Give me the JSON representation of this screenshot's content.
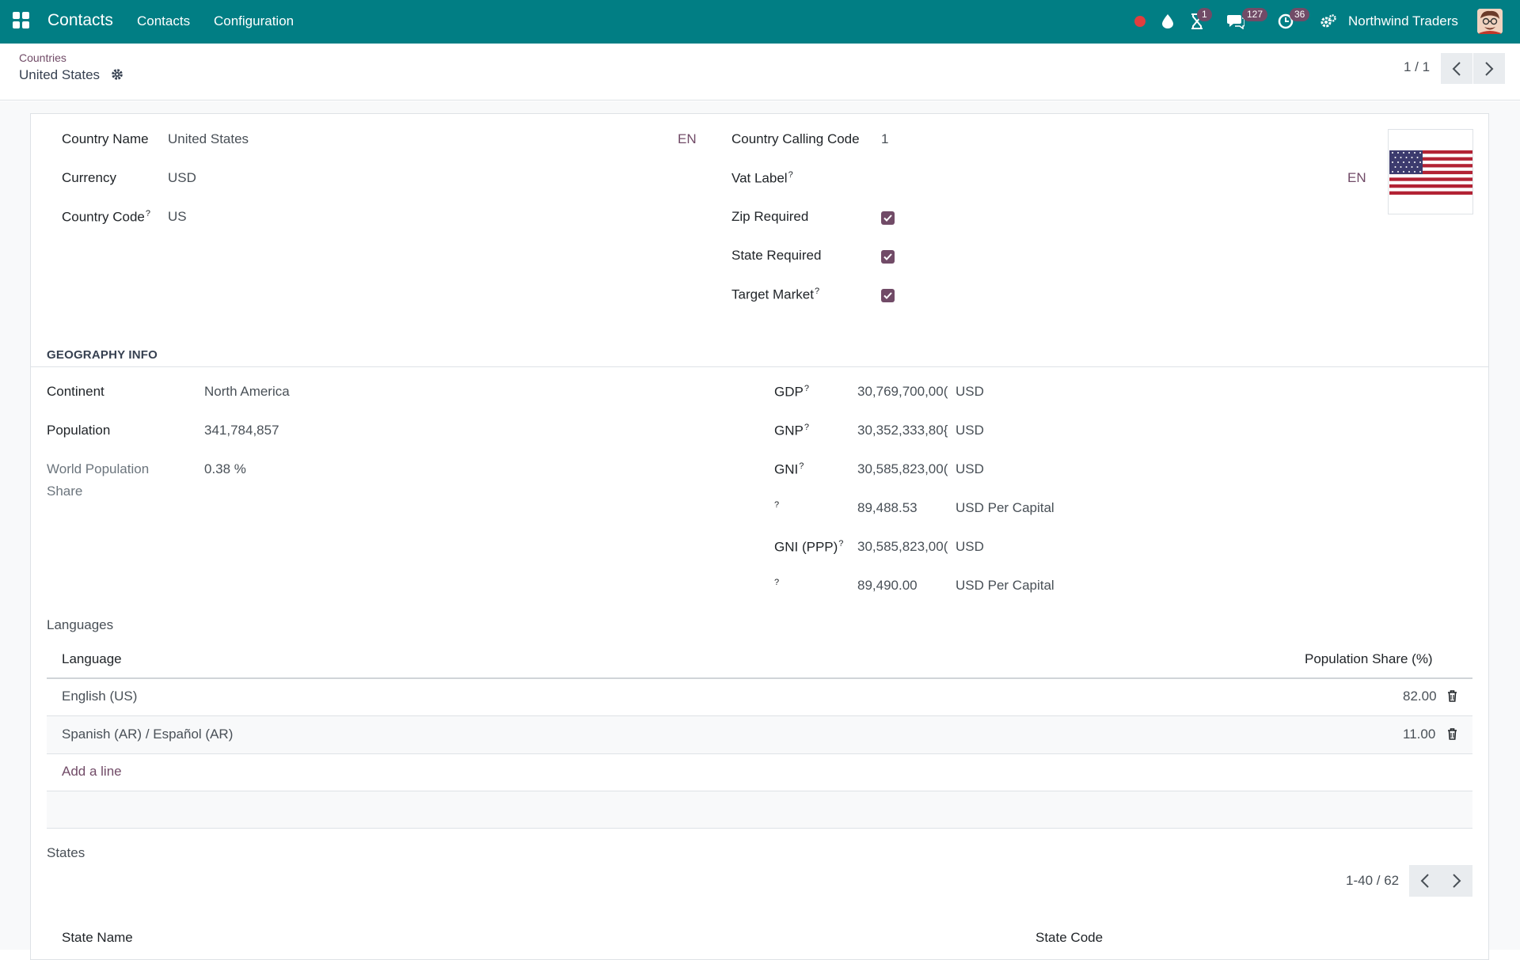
{
  "navbar": {
    "app_name": "Contacts",
    "menus": [
      "Contacts",
      "Configuration"
    ],
    "activity_badge": "1",
    "messages_badge": "127",
    "clock_badge": "36",
    "company": "Northwind Traders",
    "color": "#017e84"
  },
  "control_panel": {
    "breadcrumb_parent": "Countries",
    "record_title": "United States",
    "pager": "1 / 1"
  },
  "form": {
    "country_name": {
      "label": "Country Name",
      "value": "United States",
      "lang": "EN"
    },
    "currency": {
      "label": "Currency",
      "value": "USD"
    },
    "country_code": {
      "label": "Country Code",
      "value": "US",
      "help": "?"
    },
    "calling_code": {
      "label": "Country Calling Code",
      "value": "1"
    },
    "vat_label": {
      "label": "Vat Label",
      "help": "?",
      "lang": "EN"
    },
    "zip_required": {
      "label": "Zip Required",
      "checked": true
    },
    "state_required": {
      "label": "State Required",
      "checked": true
    },
    "target_market": {
      "label": "Target Market",
      "help": "?",
      "checked": true
    }
  },
  "geography": {
    "title": "GEOGRAPHY INFO",
    "continent": {
      "label": "Continent",
      "value": "North America"
    },
    "population": {
      "label": "Population",
      "value": "341,784,857"
    },
    "world_share": {
      "label_line1": "World Population",
      "label_line2": "Share",
      "value": "0.38 %"
    },
    "gdp": {
      "label": "GDP",
      "help": "?",
      "value": "30,769,700,00(",
      "unit": "USD"
    },
    "gnp": {
      "label": "GNP",
      "help": "?",
      "value": "30,352,333,80{",
      "unit": "USD"
    },
    "gni": {
      "label": "GNI",
      "help": "?",
      "value": "30,585,823,00(",
      "unit": "USD"
    },
    "gni_per_capita": {
      "help": "?",
      "value": "89,488.53",
      "unit": "USD Per Capital"
    },
    "gni_ppp": {
      "label": "GNI (PPP)",
      "help": "?",
      "value": "30,585,823,00(",
      "unit": "USD"
    },
    "gni_ppp_per_capita": {
      "help": "?",
      "value": "89,490.00",
      "unit": "USD Per Capital"
    }
  },
  "languages": {
    "title": "Languages",
    "col_language": "Language",
    "col_share": "Population Share (%)",
    "rows": [
      {
        "language": "English (US)",
        "share": "82.00"
      },
      {
        "language": "Spanish (AR) / Español (AR)",
        "share": "11.00"
      }
    ],
    "add_line": "Add a line"
  },
  "states": {
    "title": "States",
    "pager": "1-40 / 62",
    "col_name": "State Name",
    "col_code": "State Code"
  },
  "colors": {
    "accent": "#714b67",
    "brand": "#017e84"
  }
}
